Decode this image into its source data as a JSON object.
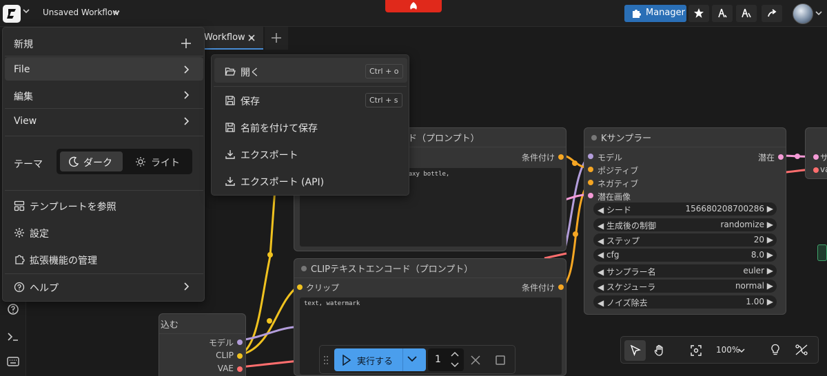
{
  "colors": {
    "accent": "#2a6fb6",
    "run": "#4a9eed",
    "link_clip": "#f0c21f",
    "link_model": "#b39ddb",
    "link_cond": "#f5a623",
    "link_latent": "#f49ad6",
    "link_vae": "#ff6e6e"
  },
  "topbar": {
    "workflow_title": "Unsaved Workflow",
    "manager_label": "Manager",
    "icons": [
      "star-icon",
      "node-library-icon",
      "node-library-alt-icon",
      "share-icon"
    ]
  },
  "tab": {
    "title": "Workflow"
  },
  "main_menu": {
    "new_label": "新規",
    "file_label": "File",
    "edit_label": "編集",
    "view_label": "View",
    "theme_label": "テーマ",
    "theme_dark": "ダーク",
    "theme_light": "ライト",
    "browse_templates": "テンプレートを参照",
    "settings": "設定",
    "extensions": "拡張機能の管理",
    "help": "ヘルプ"
  },
  "file_menu": {
    "open": "開く",
    "open_kbd": "Ctrl + o",
    "save": "保存",
    "save_kbd": "Ctrl + s",
    "save_as": "名前を付けて保存",
    "export": "エクスポート",
    "export_api": "エクスポート (API)"
  },
  "nodes": {
    "clip_pos": {
      "title": "ド（プロンプト）",
      "out": "条件付け",
      "text": "ttle landscape, , purple galaxy bottle,"
    },
    "clip_neg": {
      "title": "CLIPテキストエンコード（プロンプト）",
      "in": "クリップ",
      "out": "条件付け",
      "text": "text, watermark"
    },
    "ksampler": {
      "title": "Kサンプラー",
      "inputs": [
        "モデル",
        "ポジティブ",
        "ネガティブ",
        "潜在画像"
      ],
      "output": "潜在",
      "widgets": [
        {
          "label": "シード",
          "value": "156680208700286"
        },
        {
          "label": "生成後の制御",
          "value": "randomize"
        },
        {
          "label": "ステップ",
          "value": "20"
        },
        {
          "label": "cfg",
          "value": "8.0"
        },
        {
          "label": "サンプラー名",
          "value": "euler"
        },
        {
          "label": "スケジューラ",
          "value": "normal"
        },
        {
          "label": "ノイズ除去",
          "value": "1.00"
        }
      ]
    },
    "loader": {
      "title": "込む",
      "outs": [
        "モデル",
        "CLIP",
        "VAE"
      ]
    },
    "decode": {
      "in1": "サ",
      "in2": "va"
    }
  },
  "runbar": {
    "run_label": "実行する",
    "count": "1"
  },
  "canvas_tools": {
    "zoom": "100%"
  }
}
